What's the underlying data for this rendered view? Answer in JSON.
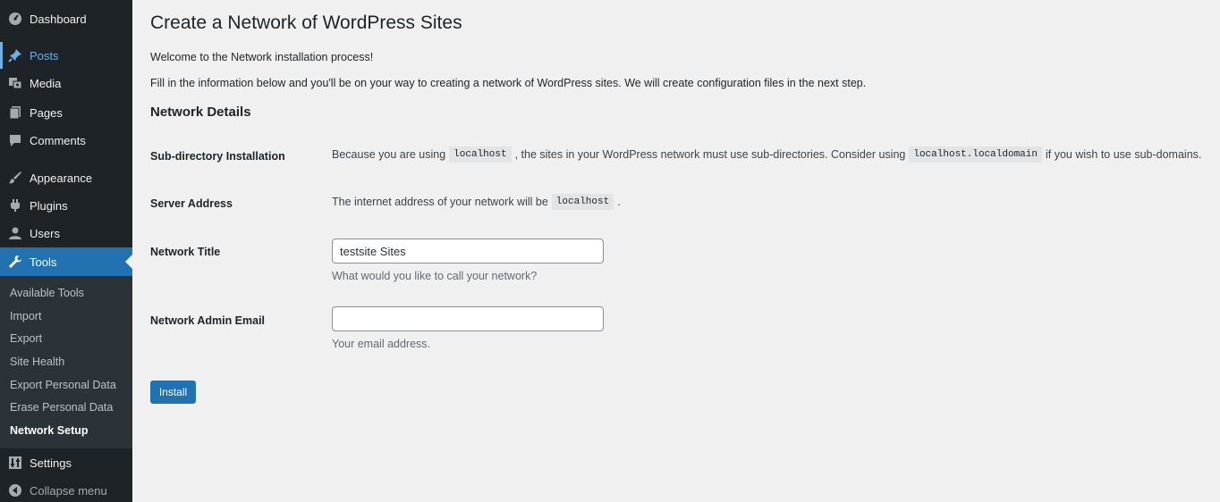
{
  "sidebar": {
    "items": [
      {
        "label": "Dashboard",
        "icon": "dashboard-icon"
      },
      {
        "label": "Posts",
        "icon": "pin-icon"
      },
      {
        "label": "Media",
        "icon": "media-icon"
      },
      {
        "label": "Pages",
        "icon": "pages-icon"
      },
      {
        "label": "Comments",
        "icon": "comments-icon"
      },
      {
        "label": "Appearance",
        "icon": "brush-icon"
      },
      {
        "label": "Plugins",
        "icon": "plugin-icon"
      },
      {
        "label": "Users",
        "icon": "user-icon"
      },
      {
        "label": "Tools",
        "icon": "wrench-icon"
      },
      {
        "label": "Settings",
        "icon": "settings-icon"
      },
      {
        "label": "Collapse menu",
        "icon": "collapse-icon"
      }
    ],
    "submenu": [
      "Available Tools",
      "Import",
      "Export",
      "Site Health",
      "Export Personal Data",
      "Erase Personal Data",
      "Network Setup"
    ],
    "colors": {
      "background": "#1d2327",
      "active": "#2271b1",
      "submenu": "#2c3338",
      "posts_accent": "#72aee6"
    }
  },
  "main": {
    "title": "Create a Network of WordPress Sites",
    "welcome": "Welcome to the Network installation process!",
    "intro": "Fill in the information below and you'll be on your way to creating a network of WordPress sites. We will create configuration files in the next step.",
    "section_title": "Network Details",
    "subdirectory": {
      "label": "Sub-directory Installation",
      "text_1": "Because you are using",
      "code_1": "localhost",
      "text_2": ", the sites in your WordPress network must use sub-directories. Consider using",
      "code_2": "localhost.localdomain",
      "text_3": "if you wish to use sub-domains."
    },
    "server_address": {
      "label": "Server Address",
      "text_1": "The internet address of your network will be",
      "code": "localhost",
      "text_2": "."
    },
    "network_title": {
      "label": "Network Title",
      "value": "testsite Sites",
      "description": "What would you like to call your network?"
    },
    "admin_email": {
      "label": "Network Admin Email",
      "value": "",
      "description": "Your email address."
    },
    "install_label": "Install",
    "colors": {
      "button": "#2271b1",
      "background": "#f0f0f1"
    }
  }
}
